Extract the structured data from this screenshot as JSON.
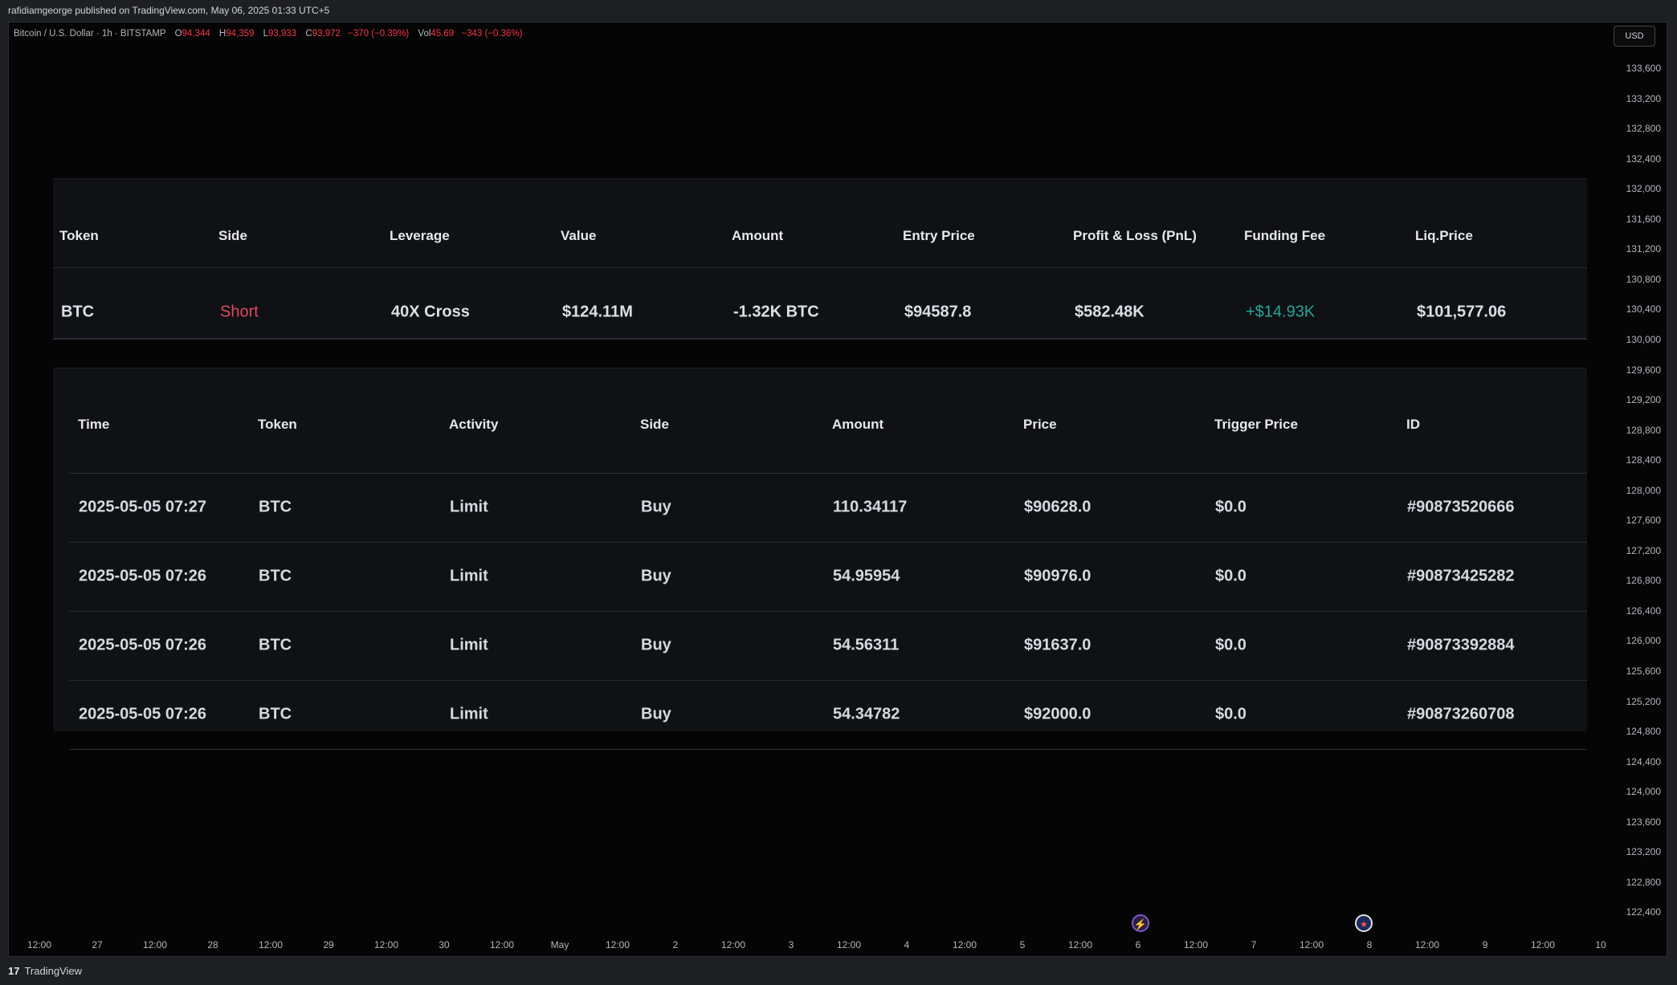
{
  "publish_line": "rafidiamgeorge published on TradingView.com, May 06, 2025 01:33 UTC+5",
  "legend": {
    "symbol": "Bitcoin / U.S. Dollar · 1h · BITSTAMP",
    "o_label": "O",
    "o_value": "94,344",
    "h_label": "H",
    "h_value": "94,359",
    "l_label": "L",
    "l_value": "93,933",
    "c_label": "C",
    "c_value": "93,972",
    "change": "−370 (−0.39%)",
    "vol_label": "Vol",
    "vol_value": "45.69",
    "vol_change": "−343 (−0.36%)"
  },
  "currency": "USD",
  "price_axis": [
    "133,600",
    "133,200",
    "132,800",
    "132,400",
    "132,000",
    "131,600",
    "131,200",
    "130,800",
    "130,400",
    "130,000",
    "129,600",
    "129,200",
    "128,800",
    "128,400",
    "128,000",
    "127,600",
    "127,200",
    "126,800",
    "126,400",
    "126,000",
    "125,600",
    "125,200",
    "124,800",
    "124,400",
    "124,000",
    "123,600",
    "123,200",
    "122,800",
    "122,400"
  ],
  "time_axis": [
    "12:00",
    "27",
    "12:00",
    "28",
    "12:00",
    "29",
    "12:00",
    "30",
    "12:00",
    "May",
    "12:00",
    "2",
    "12:00",
    "3",
    "12:00",
    "4",
    "12:00",
    "5",
    "12:00",
    "6",
    "12:00",
    "7",
    "12:00",
    "8",
    "12:00",
    "9",
    "12:00",
    "10"
  ],
  "position": {
    "headers": [
      "Token",
      "Side",
      "Leverage",
      "Value",
      "Amount",
      "Entry Price",
      "Profit & Loss (PnL)",
      "Funding Fee",
      "Liq.Price"
    ],
    "row": {
      "token": "BTC",
      "side": "Short",
      "leverage": "40X Cross",
      "value": "$124.11M",
      "amount": "-1.32K BTC",
      "entry_price": "$94587.8",
      "pnl": "$582.48K",
      "funding_fee": "+$14.93K",
      "liq_price": "$101,577.06"
    }
  },
  "orders": {
    "headers": [
      "Time",
      "Token",
      "Activity",
      "Side",
      "Amount",
      "Price",
      "Trigger Price",
      "ID"
    ],
    "rows": [
      [
        "2025-05-05 07:27",
        "BTC",
        "Limit",
        "Buy",
        "110.34117",
        "$90628.0",
        "$0.0",
        "#90873520666"
      ],
      [
        "2025-05-05 07:26",
        "BTC",
        "Limit",
        "Buy",
        "54.95954",
        "$90976.0",
        "$0.0",
        "#90873425282"
      ],
      [
        "2025-05-05 07:26",
        "BTC",
        "Limit",
        "Buy",
        "54.56311",
        "$91637.0",
        "$0.0",
        "#90873392884"
      ],
      [
        "2025-05-05 07:26",
        "BTC",
        "Limit",
        "Buy",
        "54.34782",
        "$92000.0",
        "$0.0",
        "#90873260708"
      ]
    ]
  },
  "footer_brand": "TradingView",
  "footer_logo": "17",
  "colors": {
    "short": "#e04a5a",
    "funding": "#26a69a",
    "legend_red": "#f23645"
  },
  "icons": [
    "lightning-event-icon",
    "us-flag-event-icon",
    "tradingview-logo-icon"
  ]
}
